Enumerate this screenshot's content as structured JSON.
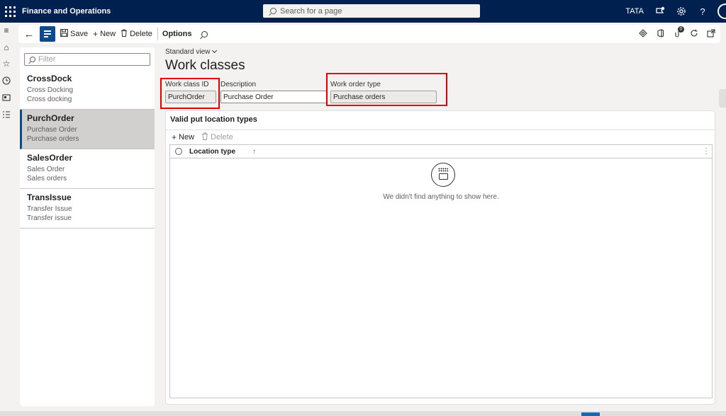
{
  "header": {
    "app_title": "Finance and Operations",
    "search_placeholder": "Search for a page",
    "company": "TATA",
    "notification_count": ""
  },
  "actionpane": {
    "save_label": "Save",
    "new_label": "New",
    "delete_label": "Delete",
    "options_label": "Options",
    "attachments_count": "0"
  },
  "listpane": {
    "filter_placeholder": "Filter",
    "items": [
      {
        "id": "CrossDock",
        "line1": "Cross Docking",
        "line2": "Cross docking",
        "selected": false
      },
      {
        "id": "PurchOrder",
        "line1": "Purchase Order",
        "line2": "Purchase orders",
        "selected": true
      },
      {
        "id": "SalesOrder",
        "line1": "Sales Order",
        "line2": "Sales orders",
        "selected": false
      },
      {
        "id": "TransIssue",
        "line1": "Transfer Issue",
        "line2": "Transfer issue",
        "selected": false
      }
    ]
  },
  "form": {
    "view_name": "Standard view",
    "title": "Work classes",
    "work_class_id_label": "Work class ID",
    "work_class_id_value": "PurchOrder",
    "description_label": "Description",
    "description_value": "Purchase Order",
    "work_order_type_label": "Work order type",
    "work_order_type_value": "Purchase orders"
  },
  "fasttab": {
    "title": "Valid put location types",
    "new_label": "New",
    "delete_label": "Delete",
    "column_header": "Location type",
    "empty_message": "We didn't find anything to show here."
  },
  "colors": {
    "nav_bar": "#002050",
    "accent": "#0f4a8a",
    "highlight_box": "#e00000"
  }
}
